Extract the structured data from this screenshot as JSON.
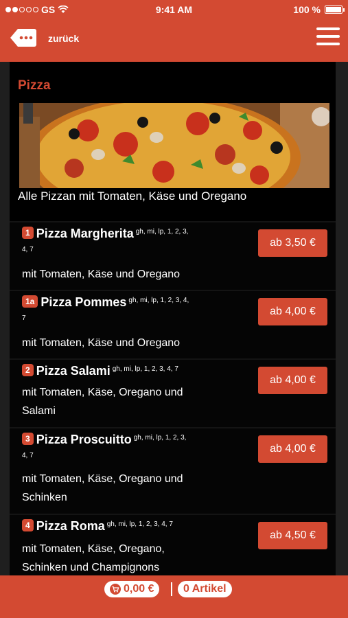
{
  "status_bar": {
    "carrier": "GS",
    "time": "9:41 AM",
    "battery": "100 %"
  },
  "header": {
    "back_label": "zurück"
  },
  "section": {
    "title": "Pizza",
    "intro": "Alle Pizzan mit Tomaten, Käse und Oregano"
  },
  "items": [
    {
      "num": "1",
      "name": "Pizza Margherita",
      "allergens": "gh, mi, lp, 1, 2, 3,",
      "allergens2": "4, 7",
      "desc": "mit Tomaten, Käse und Oregano",
      "desc2": "",
      "price": "ab 3,50 €"
    },
    {
      "num": "1a",
      "name": "Pizza Pommes",
      "allergens": "gh, mi, lp, 1, 2, 3, 4,",
      "allergens2": "7",
      "desc": "mit Tomaten, Käse und Oregano",
      "desc2": "",
      "price": "ab 4,00 €"
    },
    {
      "num": "2",
      "name": "Pizza Salami",
      "allergens": "gh, mi, lp, 1, 2, 3, 4, 7",
      "allergens2": "",
      "desc": "mit Tomaten, Käse, Oregano und",
      "desc2": "Salami",
      "price": "ab 4,00 €"
    },
    {
      "num": "3",
      "name": "Pizza Proscuitto",
      "allergens": "gh, mi, lp, 1, 2, 3,",
      "allergens2": "4, 7",
      "desc": "mit Tomaten, Käse, Oregano und",
      "desc2": "Schinken",
      "price": "ab 4,00 €"
    },
    {
      "num": "4",
      "name": "Pizza Roma",
      "allergens": "gh, mi, lp, 1, 2, 3, 4, 7",
      "allergens2": "",
      "desc": "mit Tomaten, Käse, Oregano,",
      "desc2": "Schinken und Champignons",
      "price": "ab 4,50 €"
    }
  ],
  "footer": {
    "cart_total": "0,00 €",
    "article_count": "0 Artikel"
  },
  "colors": {
    "accent": "#d34a32",
    "background": "#000000"
  }
}
